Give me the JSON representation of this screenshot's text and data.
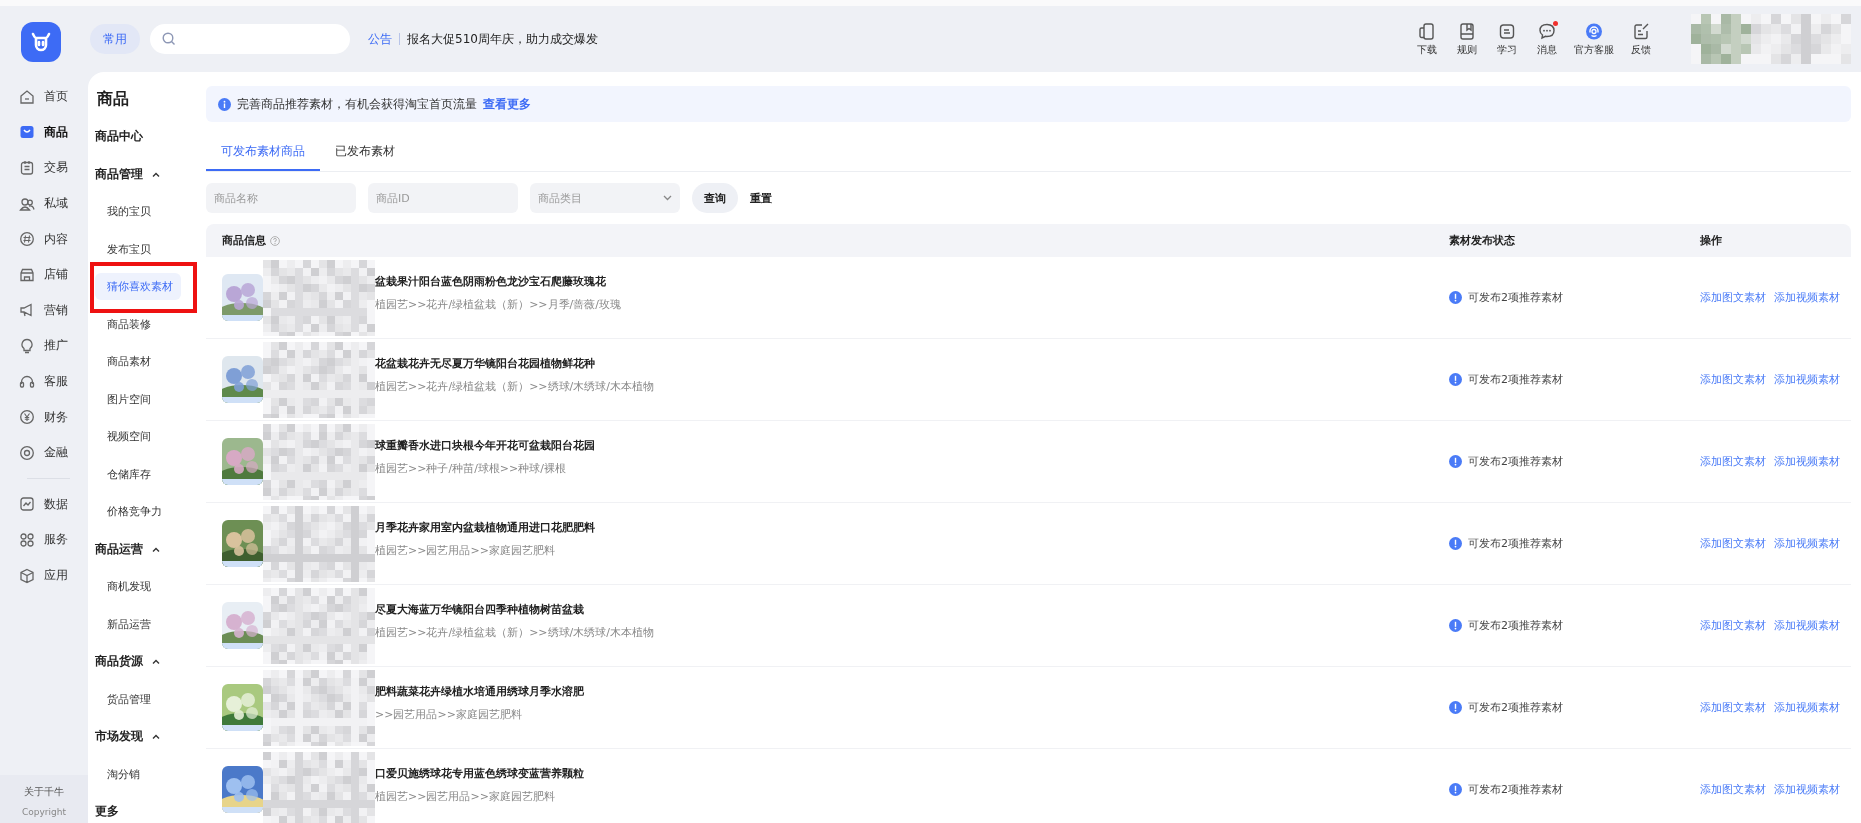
{
  "rail": {
    "primary_items": [
      {
        "label": "首页",
        "selected": false
      },
      {
        "label": "商品",
        "selected": true
      },
      {
        "label": "交易",
        "selected": false
      },
      {
        "label": "私域",
        "selected": false
      },
      {
        "label": "内容",
        "selected": false
      },
      {
        "label": "店铺",
        "selected": false
      },
      {
        "label": "营销",
        "selected": false
      },
      {
        "label": "推广",
        "selected": false
      },
      {
        "label": "客服",
        "selected": false
      },
      {
        "label": "财务",
        "selected": false
      },
      {
        "label": "金融",
        "selected": false
      }
    ],
    "secondary_items": [
      {
        "label": "数据",
        "selected": false
      },
      {
        "label": "服务",
        "selected": false
      },
      {
        "label": "应用",
        "selected": false
      }
    ],
    "footer": "关于千牛",
    "copyright": "Copyright"
  },
  "header": {
    "quick_button": "常用",
    "announcement": {
      "label": "公告",
      "text": "报名大促510周年庆，助力成交爆发"
    },
    "tools": [
      {
        "label": "下载",
        "kind": "download",
        "unread": false
      },
      {
        "label": "规则",
        "kind": "rules",
        "unread": false
      },
      {
        "label": "学习",
        "kind": "learn",
        "unread": false
      },
      {
        "label": "消息",
        "kind": "message",
        "unread": true
      },
      {
        "label": "官方客服",
        "kind": "support",
        "unread": false
      },
      {
        "label": "反馈",
        "kind": "feedback",
        "unread": false
      }
    ]
  },
  "submenu": {
    "title": "商品",
    "sections": [
      {
        "label": "商品中心",
        "kind": "link"
      },
      {
        "label": "商品管理",
        "kind": "group",
        "expanded": true,
        "children": [
          {
            "label": "我的宝贝",
            "selected": false,
            "highlighted": false
          },
          {
            "label": "发布宝贝",
            "selected": false,
            "highlighted": false
          },
          {
            "label": "猜你喜欢素材",
            "selected": true,
            "highlighted": true
          },
          {
            "label": "商品装修",
            "selected": false,
            "highlighted": false
          },
          {
            "label": "商品素材",
            "selected": false,
            "highlighted": false
          },
          {
            "label": "图片空间",
            "selected": false,
            "highlighted": false
          },
          {
            "label": "视频空间",
            "selected": false,
            "highlighted": false
          },
          {
            "label": "仓储库存",
            "selected": false,
            "highlighted": false
          },
          {
            "label": "价格竞争力",
            "selected": false,
            "highlighted": false
          }
        ]
      },
      {
        "label": "商品运营",
        "kind": "group",
        "expanded": true,
        "children": [
          {
            "label": "商机发现",
            "selected": false,
            "highlighted": false
          },
          {
            "label": "新品运营",
            "selected": false,
            "highlighted": false
          }
        ]
      },
      {
        "label": "商品货源",
        "kind": "group",
        "expanded": true,
        "children": [
          {
            "label": "货品管理",
            "selected": false,
            "highlighted": false
          }
        ]
      },
      {
        "label": "市场发现",
        "kind": "group",
        "expanded": true,
        "children": [
          {
            "label": "淘分销",
            "selected": false,
            "highlighted": false
          }
        ]
      },
      {
        "label": "更多",
        "kind": "link"
      }
    ]
  },
  "notice": {
    "text": "完善商品推荐素材，有机会获得淘宝首页流量",
    "link": "查看更多"
  },
  "tabs": [
    {
      "label": "可发布素材商品",
      "selected": true
    },
    {
      "label": "已发布素材",
      "selected": false
    }
  ],
  "filters": {
    "fields": [
      {
        "placeholder": "商品名称",
        "kind": "text"
      },
      {
        "placeholder": "商品ID",
        "kind": "text"
      },
      {
        "placeholder": "商品类目",
        "kind": "select"
      }
    ],
    "buttons": [
      {
        "label": "查询",
        "kind": "filled"
      },
      {
        "label": "重置",
        "kind": "plain"
      }
    ]
  },
  "table": {
    "columns": [
      {
        "label": "商品信息",
        "help": true
      },
      {
        "label": "素材发布状态",
        "help": false
      },
      {
        "label": "操作",
        "help": false
      }
    ],
    "rows": [
      {
        "title": "盆栽果汁阳台蓝色阴雨粉色龙沙宝石爬藤玫瑰花",
        "category": "植园艺>>花卉/绿植盆栽（新）>>月季/蔷薇/玫瑰",
        "status": "可发布2项推荐素材",
        "actions": [
          "添加图文素材",
          "添加视频素材"
        ]
      },
      {
        "title": "花盆栽花卉无尽夏万华镜阳台花园植物鲜花种",
        "category": "植园艺>>花卉/绿植盆栽（新）>>绣球/木绣球/木本植物",
        "status": "可发布2项推荐素材",
        "actions": [
          "添加图文素材",
          "添加视频素材"
        ]
      },
      {
        "title": "球重瓣香水进口块根今年开花可盆栽阳台花园",
        "category": "植园艺>>种子/种苗/球根>>种球/裸根",
        "status": "可发布2项推荐素材",
        "actions": [
          "添加图文素材",
          "添加视频素材"
        ]
      },
      {
        "title": "月季花卉家用室内盆栽植物通用进口花肥肥料",
        "category": "植园艺>>园艺用品>>家庭园艺肥料",
        "status": "可发布2项推荐素材",
        "actions": [
          "添加图文素材",
          "添加视频素材"
        ]
      },
      {
        "title": "尽夏大海蓝万华镜阳台四季种植物树苗盆栽",
        "category": "植园艺>>花卉/绿植盆栽（新）>>绣球/木绣球/木本植物",
        "status": "可发布2项推荐素材",
        "actions": [
          "添加图文素材",
          "添加视频素材"
        ]
      },
      {
        "title": "肥料蔬菜花卉绿植水培通用绣球月季水溶肥",
        "category": ">>园艺用品>>家庭园艺肥料",
        "status": "可发布2项推荐素材",
        "actions": [
          "添加图文素材",
          "添加视频素材"
        ]
      },
      {
        "title": "口爱贝施绣球花专用蓝色绣球变蓝营养颗粒",
        "category": "植园艺>>园艺用品>>家庭园艺肥料",
        "status": "可发布2项推荐素材",
        "actions": [
          "添加图文素材",
          "添加视频素材"
        ]
      }
    ]
  }
}
